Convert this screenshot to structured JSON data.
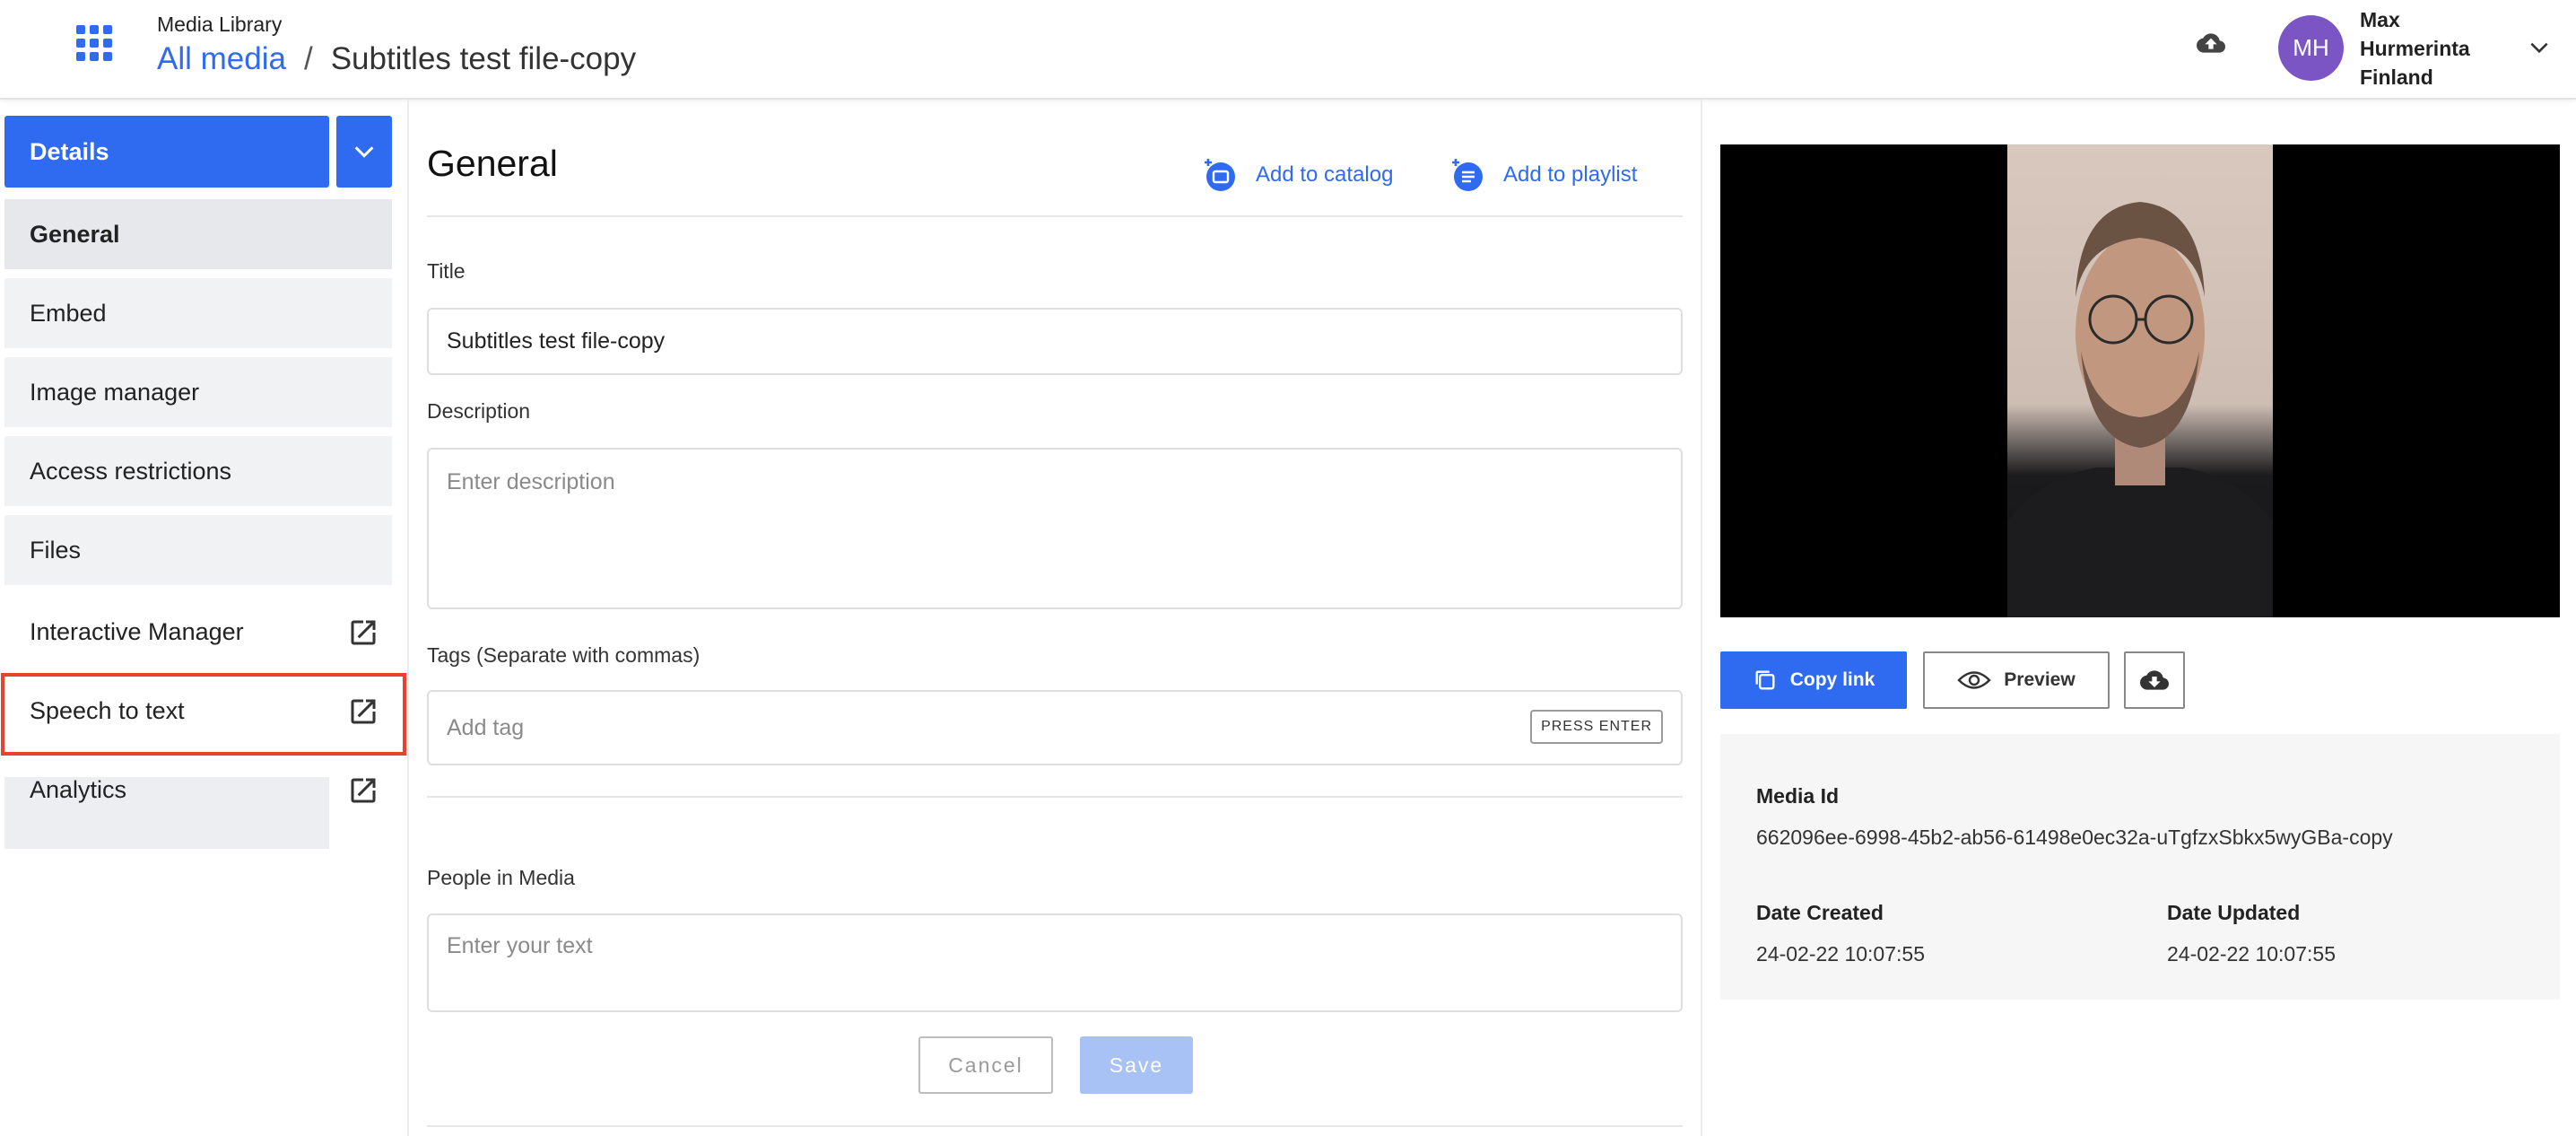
{
  "header": {
    "app_name": "Media Library",
    "breadcrumb_link": "All media",
    "breadcrumb_sep": "/",
    "breadcrumb_current": "Subtitles test file-copy",
    "user": {
      "initials": "MH",
      "first_name": "Max",
      "last_name": "Hurmerinta",
      "country": "Finland",
      "avatar_color": "#7b55c4"
    }
  },
  "sidebar": {
    "details_label": "Details",
    "items": [
      {
        "label": "General"
      },
      {
        "label": "Embed"
      },
      {
        "label": "Image manager"
      },
      {
        "label": "Access restrictions"
      },
      {
        "label": "Files"
      }
    ],
    "external_links": [
      {
        "label": "Interactive Manager"
      },
      {
        "label": "Speech to text"
      },
      {
        "label": "Analytics"
      }
    ]
  },
  "main": {
    "section_title": "General",
    "add_to_catalog": "Add to catalog",
    "add_to_playlist": "Add to playlist",
    "title_label": "Title",
    "title_value": "Subtitles test file-copy",
    "description_label": "Description",
    "description_placeholder": "Enter description",
    "tags_label": "Tags (Separate with commas)",
    "tags_placeholder": "Add tag",
    "press_enter": "PRESS ENTER",
    "people_label": "People in Media",
    "people_placeholder": "Enter your text",
    "cancel_label": "Cancel",
    "save_label": "Save"
  },
  "right": {
    "copy_link": "Copy link",
    "preview": "Preview",
    "media_id_label": "Media Id",
    "media_id_value": "662096ee-6998-45b2-ab56-61498e0ec32a-uTgfzxSbkx5wyGBa-copy",
    "date_created_label": "Date Created",
    "date_created_value": "24-02-22 10:07:55",
    "date_updated_label": "Date Updated",
    "date_updated_value": "24-02-22 10:07:55"
  },
  "colors": {
    "accent": "#2f6bf0",
    "highlight": "#e8412c"
  }
}
